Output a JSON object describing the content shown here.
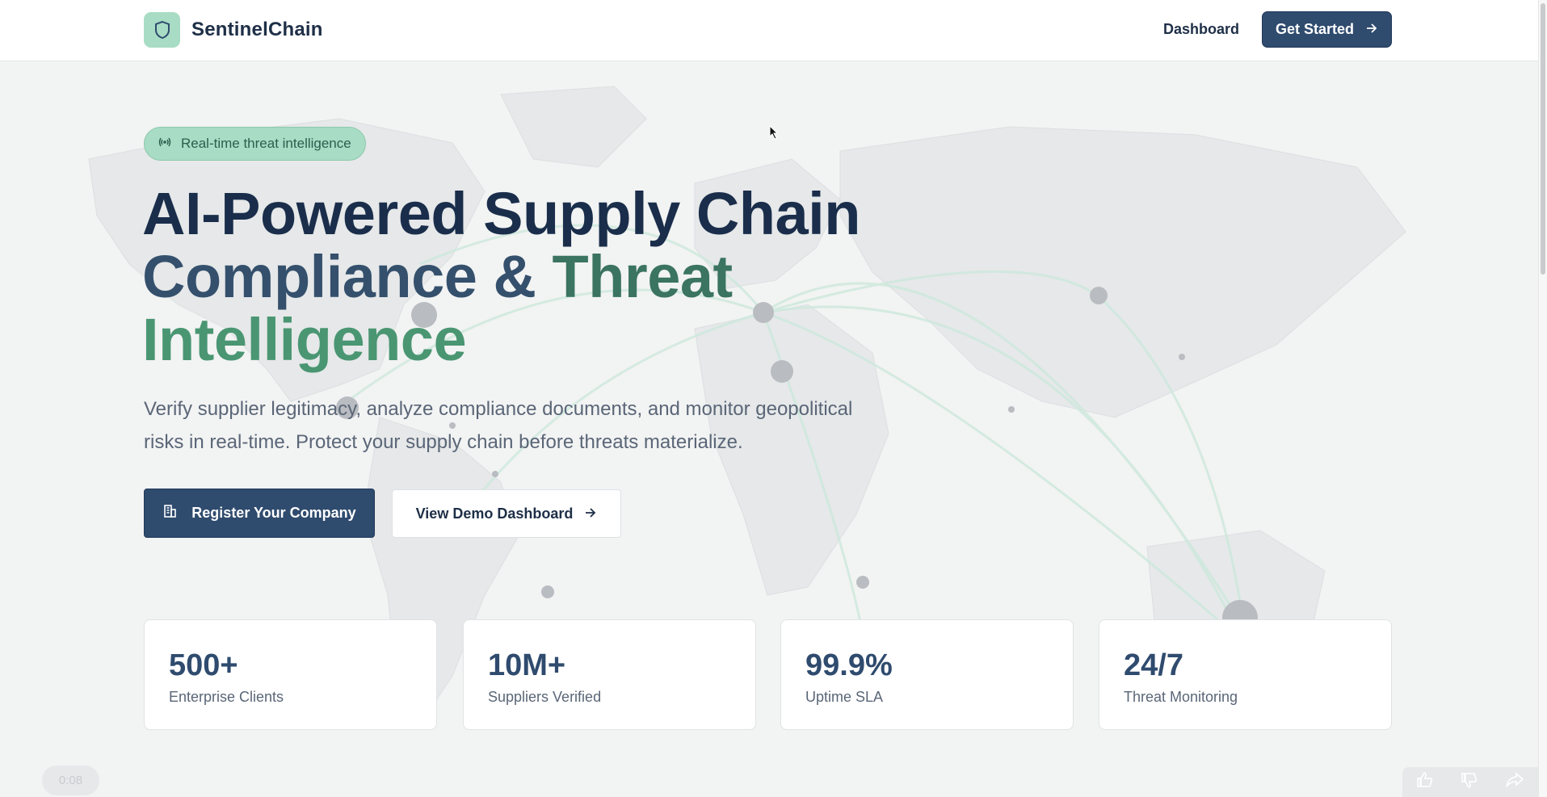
{
  "header": {
    "brand_name": "SentinelChain",
    "nav_dashboard": "Dashboard",
    "cta_label": "Get Started"
  },
  "hero": {
    "badge_label": "Real-time threat intelligence",
    "title_line1": "AI-Powered Supply Chain",
    "title_line2a": "Compliance & ",
    "title_line2b": "Threat",
    "title_line3": "Intelligence",
    "subtitle_line1": "Verify supplier legitimacy, analyze compliance documents, and monitor geopolitical",
    "subtitle_line2": "risks in real-time. Protect your supply chain before threats materialize.",
    "primary_button": "Register Your Company",
    "secondary_button": "View Demo Dashboard"
  },
  "stats": [
    {
      "value": "500+",
      "label": "Enterprise Clients"
    },
    {
      "value": "10M+",
      "label": "Suppliers Verified"
    },
    {
      "value": "99.9%",
      "label": "Uptime SLA"
    },
    {
      "value": "24/7",
      "label": "Threat Monitoring"
    }
  ],
  "player": {
    "timecode": "0:08"
  },
  "colors": {
    "primary": "#2f4b6e",
    "accent_green": "#4a9672",
    "badge_bg": "#a8dcc4",
    "navy_text": "#1a2e4b"
  },
  "icons": [
    "shield-icon",
    "broadcast-icon",
    "arrow-right-icon",
    "building-icon",
    "thumbs-up-icon",
    "thumbs-down-icon",
    "share-icon"
  ]
}
